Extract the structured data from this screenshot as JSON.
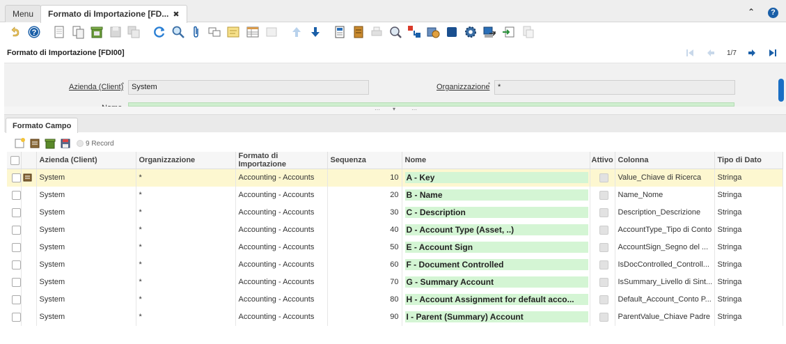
{
  "tabs": {
    "menu_label": "Menu",
    "window_label": "Formato di Importazione [FD...",
    "close_symbol": "✖"
  },
  "topright": {
    "collapse_symbol": "⌃",
    "help_symbol": "?"
  },
  "header": {
    "title": "Formato di Importazione [FDI00]",
    "page_indicator": "1/7"
  },
  "form": {
    "client_label": "Azienda (Client)",
    "client_value": "System",
    "org_label": "Organizzazione",
    "org_value": "*",
    "name_label": "Nome"
  },
  "detail": {
    "tab_label": "Formato Campo",
    "record_count": "9 Record"
  },
  "grid": {
    "headers": [
      "Azienda (Client)",
      "Organizzazione",
      "Formato di Importazione",
      "Sequenza",
      "Nome",
      "Attivo",
      "Colonna",
      "Tipo di Dato"
    ],
    "rows": [
      {
        "client": "System",
        "org": "*",
        "format": "Accounting - Accounts",
        "seq": "10",
        "name": "A - Key",
        "column": "Value_Chiave di Ricerca",
        "type": "Stringa"
      },
      {
        "client": "System",
        "org": "*",
        "format": "Accounting - Accounts",
        "seq": "20",
        "name": "B - Name",
        "column": "Name_Nome",
        "type": "Stringa"
      },
      {
        "client": "System",
        "org": "*",
        "format": "Accounting - Accounts",
        "seq": "30",
        "name": "C - Description",
        "column": "Description_Descrizione",
        "type": "Stringa"
      },
      {
        "client": "System",
        "org": "*",
        "format": "Accounting - Accounts",
        "seq": "40",
        "name": "D - Account Type (Asset, ..)",
        "column": "AccountType_Tipo di Conto",
        "type": "Stringa"
      },
      {
        "client": "System",
        "org": "*",
        "format": "Accounting - Accounts",
        "seq": "50",
        "name": "E - Account Sign",
        "column": "AccountSign_Segno del ...",
        "type": "Stringa"
      },
      {
        "client": "System",
        "org": "*",
        "format": "Accounting - Accounts",
        "seq": "60",
        "name": "F - Document Controlled",
        "column": "IsDocControlled_Controll...",
        "type": "Stringa"
      },
      {
        "client": "System",
        "org": "*",
        "format": "Accounting - Accounts",
        "seq": "70",
        "name": "G - Summary Account",
        "column": "IsSummary_Livello di Sint...",
        "type": "Stringa"
      },
      {
        "client": "System",
        "org": "*",
        "format": "Accounting - Accounts",
        "seq": "80",
        "name": "H - Account Assignment for default acco...",
        "column": "Default_Account_Conto P...",
        "type": "Stringa"
      },
      {
        "client": "System",
        "org": "*",
        "format": "Accounting - Accounts",
        "seq": "90",
        "name": "I - Parent (Summary) Account",
        "column": "ParentValue_Chiave Padre",
        "type": "Stringa"
      }
    ]
  },
  "colors": {
    "accent": "#1a5fa8",
    "mandatory_field": "#d4f5d4",
    "selected_row": "#fdf7d0"
  }
}
